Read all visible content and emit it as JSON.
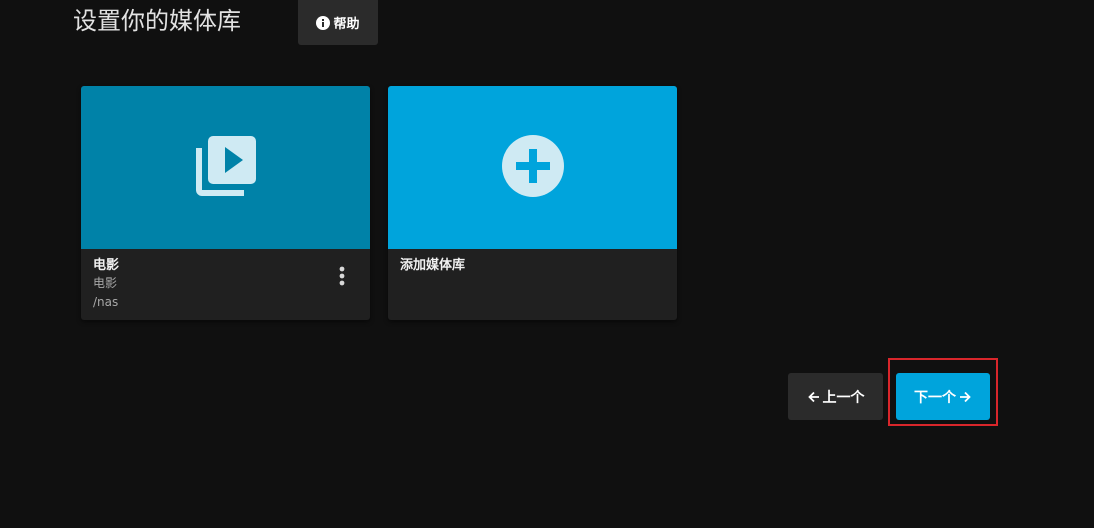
{
  "header": {
    "title": "设置你的媒体库",
    "help_label": "帮助"
  },
  "libraries": [
    {
      "title": "电影",
      "type": "电影",
      "path": "/nas",
      "icon": "video-library-icon",
      "color": "#0082a8"
    }
  ],
  "add_card": {
    "title": "添加媒体库",
    "icon": "add-circle-icon",
    "color": "#00a4dc"
  },
  "nav": {
    "prev_label": "上一个",
    "next_label": "下一个"
  },
  "colors": {
    "background": "#101010",
    "accent": "#00a4dc",
    "highlight": "#d9262b"
  }
}
